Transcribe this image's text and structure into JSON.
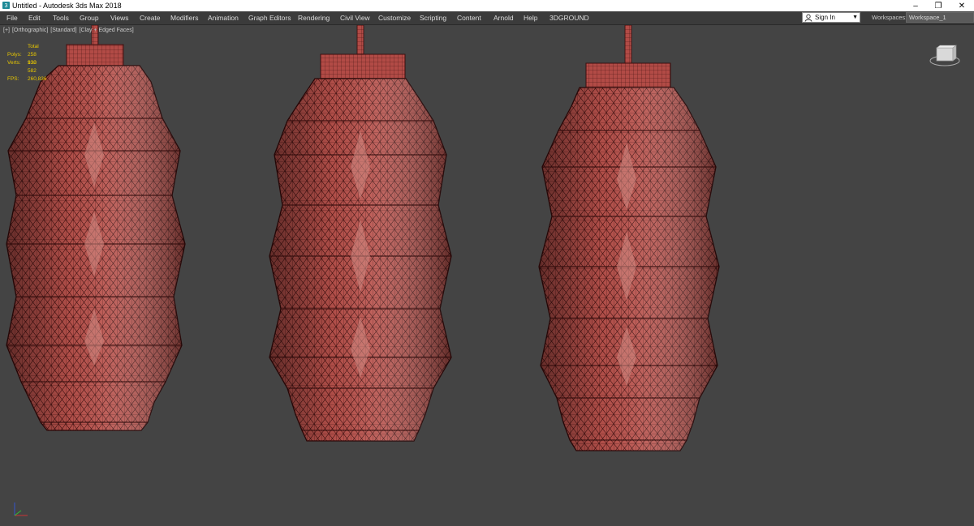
{
  "window": {
    "title": "Untitled - Autodesk 3ds Max 2018"
  },
  "menu": {
    "items": [
      "File",
      "Edit",
      "Tools",
      "Group",
      "Views",
      "Create",
      "Modifiers",
      "Animation",
      "Graph Editors",
      "Rendering",
      "Civil View",
      "Customize",
      "Scripting",
      "Content",
      "Arnold",
      "Help",
      "3DGROUND"
    ]
  },
  "account": {
    "sign_in_label": "Sign In"
  },
  "workspace": {
    "label": "Workspaces:",
    "selected": "Workspace_1"
  },
  "viewport": {
    "labels": [
      "[+]",
      "[Orthographic]",
      "[Standard]",
      "[Clay + Edged Faces]"
    ],
    "stats": {
      "header": "Total",
      "polys_label": "Polys:",
      "polys_value": "258 930",
      "verts_label": "Verts:",
      "verts_value": "132 582",
      "fps_label": "FPS:",
      "fps_value": "260,836"
    }
  },
  "scene": {
    "objects": [
      "pendant-lamp-left",
      "pendant-lamp-center",
      "pendant-lamp-right"
    ],
    "colors": {
      "mesh_fill": "#b64f4a",
      "wire": "#3a0d0d",
      "background": "#444444"
    }
  },
  "icons": {
    "app": "3ds-max-icon",
    "user": "user-icon",
    "minimize": "minimize-icon",
    "restore": "restore-icon",
    "close": "close-icon",
    "viewcube": "viewcube-icon",
    "axis": "axis-tripod-icon"
  }
}
